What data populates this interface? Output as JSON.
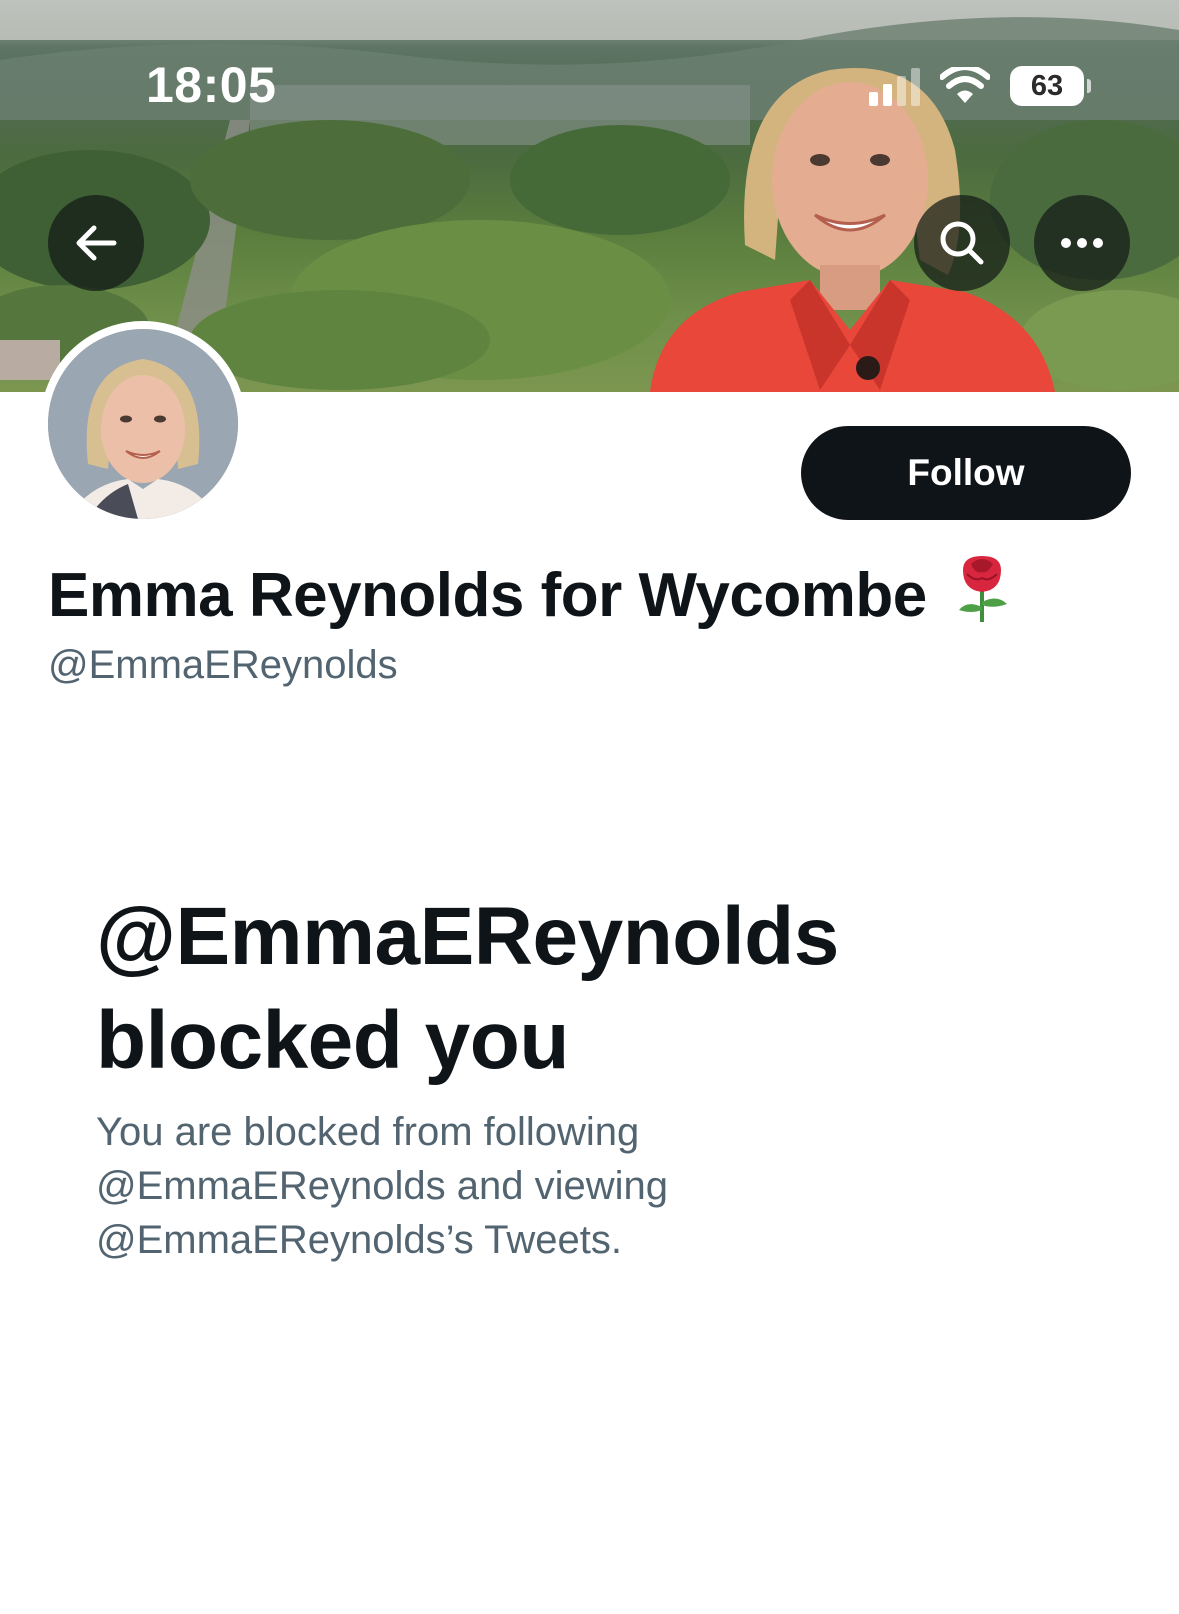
{
  "status_bar": {
    "time": "18:05",
    "battery": "63"
  },
  "banner": {
    "icon": "cover-photo"
  },
  "nav": {
    "back_icon": "arrow-left-icon",
    "search_icon": "search-icon",
    "more_icon": "more-horizontal-icon"
  },
  "profile": {
    "display_name": "Emma Reynolds for Wycombe",
    "name_emoji": "🌹",
    "handle": "@EmmaEReynolds",
    "follow_label": "Follow"
  },
  "blocked": {
    "title": "@EmmaEReynolds blocked you",
    "message": "You are blocked from following @EmmaEReynolds and viewing @EmmaEReynolds’s Tweets."
  },
  "colors": {
    "text_primary": "#0f1419",
    "text_secondary": "#536471",
    "follow_button_bg": "#0f1419",
    "jacket_red": "#e8473a"
  }
}
